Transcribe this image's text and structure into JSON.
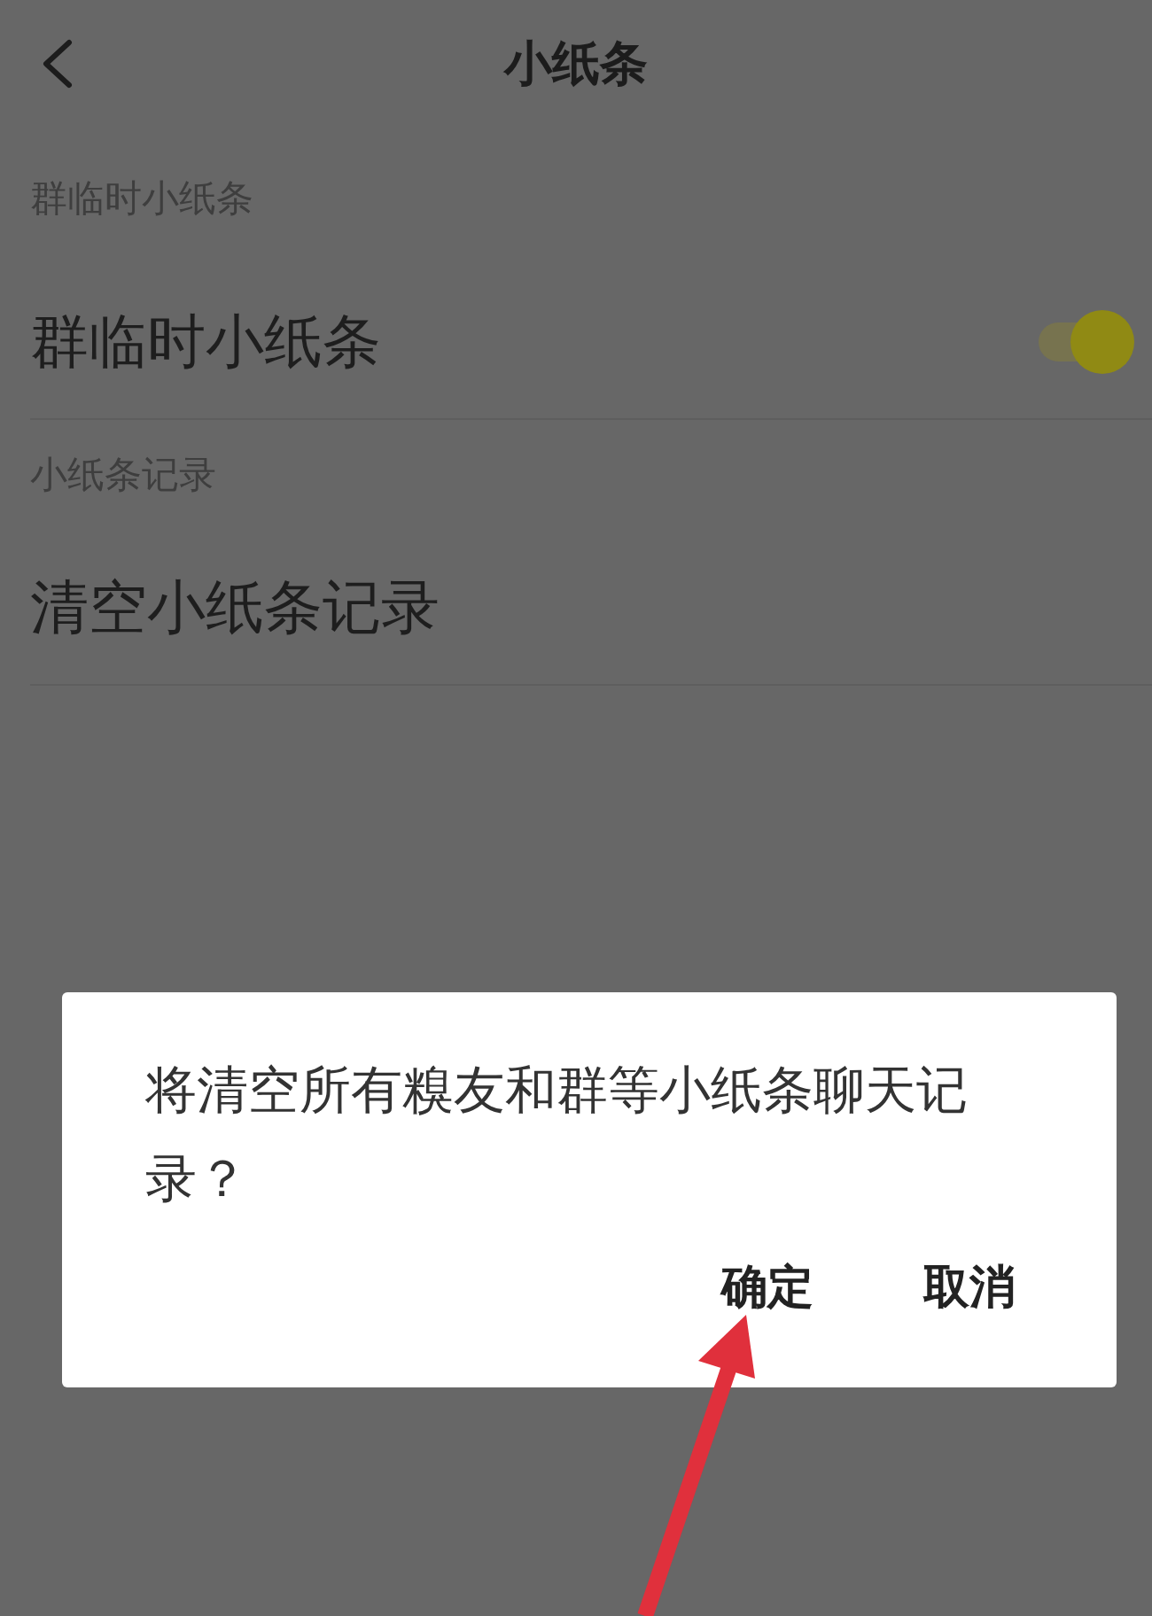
{
  "header": {
    "title": "小纸条"
  },
  "sections": [
    {
      "label": "群临时小纸条",
      "rows": [
        {
          "kind": "toggle",
          "label": "群临时小纸条",
          "on": true
        }
      ]
    },
    {
      "label": "小纸条记录",
      "rows": [
        {
          "kind": "action",
          "label": "清空小纸条记录"
        }
      ]
    }
  ],
  "dialog": {
    "message": "将清空所有糗友和群等小纸条聊天记录？",
    "buttons": [
      "确定",
      "取消"
    ]
  }
}
